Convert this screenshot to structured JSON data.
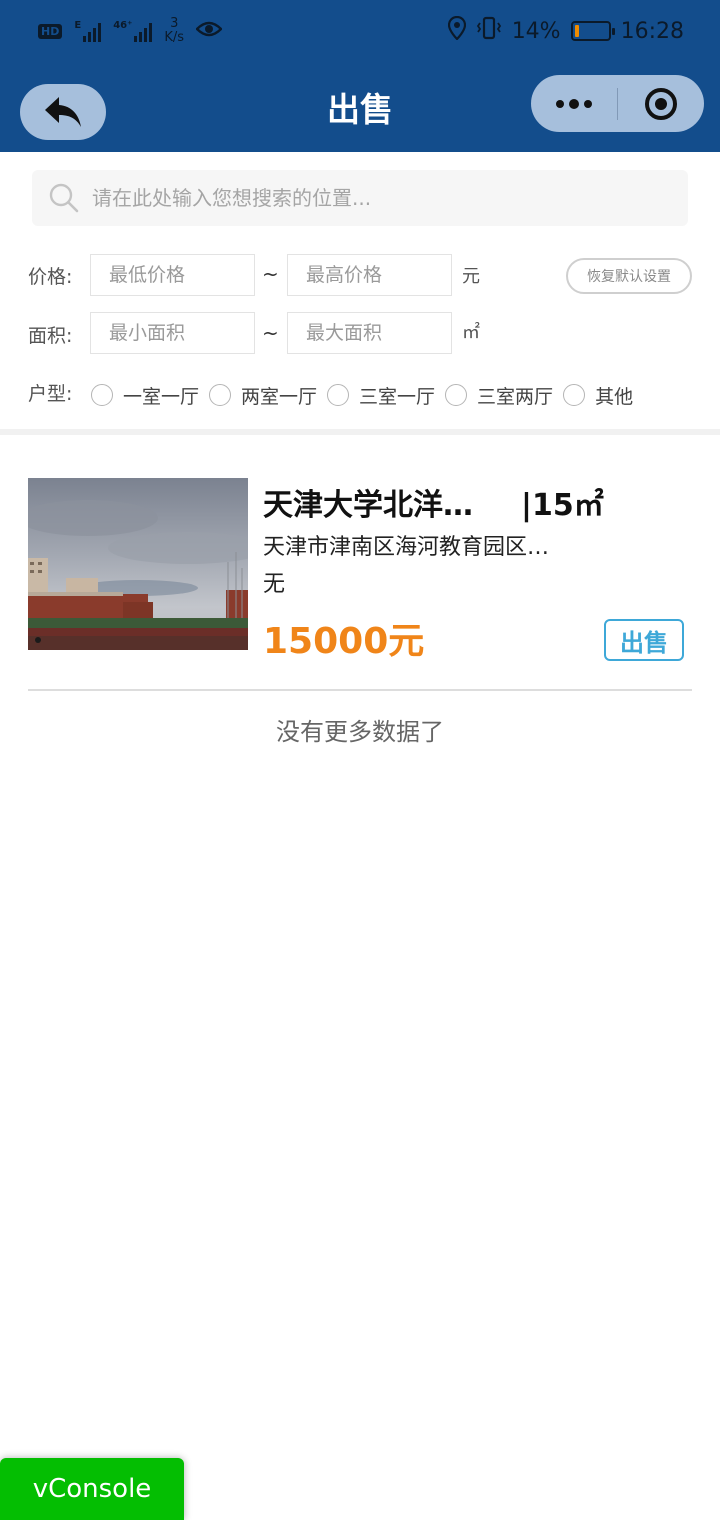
{
  "status_bar": {
    "hd_label": "HD",
    "net_label_1": "E",
    "net_label_2": "46⁺",
    "speed_value": "3",
    "speed_unit": "K/s",
    "battery_percent": "14%",
    "battery_level": 0.14,
    "time": "16:28"
  },
  "nav": {
    "title": "出售"
  },
  "search": {
    "placeholder": "请在此处输入您想搜索的位置..."
  },
  "filters": {
    "price_label": "价格:",
    "price_min_placeholder": "最低价格",
    "price_max_placeholder": "最高价格",
    "range_separator": "~",
    "price_unit": "元",
    "reset_label": "恢复默认设置",
    "area_label": "面积:",
    "area_min_placeholder": "最小面积",
    "area_max_placeholder": "最大面积",
    "area_unit": "㎡",
    "layout_label": "户型:",
    "layout_options": [
      "一室一厅",
      "两室一厅",
      "三室一厅",
      "三室两厅",
      "其他"
    ]
  },
  "listings": [
    {
      "title": "天津大学北洋…",
      "area": "|15㎡",
      "address": "天津市津南区海河教育园区…",
      "note": "无",
      "price": "15000元",
      "tag": "出售"
    }
  ],
  "footer": {
    "no_more": "没有更多数据了"
  },
  "vconsole": {
    "label": "vConsole"
  },
  "colors": {
    "nav_background": "#134d8c",
    "price": "#f08519",
    "tag": "#3ea8d8",
    "vconsole": "#04be02"
  }
}
